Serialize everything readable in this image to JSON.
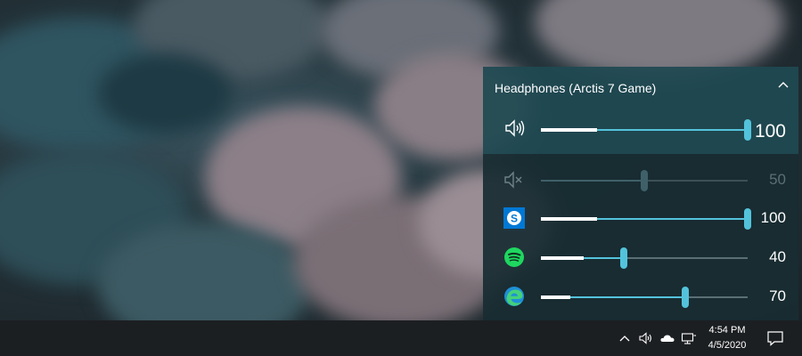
{
  "flyout": {
    "device_name": "Headphones (Arctis 7 Game)",
    "master": {
      "icon": "speaker-icon",
      "volume": 100,
      "label": "100"
    },
    "apps": [
      {
        "icon": "system-sounds-muted-icon",
        "volume": 50,
        "label": "50",
        "muted": true
      },
      {
        "icon": "skype-icon",
        "volume": 100,
        "label": "100",
        "muted": false
      },
      {
        "icon": "spotify-icon",
        "volume": 40,
        "label": "40",
        "muted": false
      },
      {
        "icon": "edge-icon",
        "volume": 70,
        "label": "70",
        "muted": false
      }
    ]
  },
  "taskbar": {
    "time": "4:54 PM",
    "date": "4/5/2020"
  },
  "colors": {
    "accent": "#53c3db",
    "panel_top": "#1f4952",
    "panel_bottom": "#182c32",
    "taskbar": "#1c1f22",
    "spotify": "#1ed760",
    "skype": "#0078d4"
  }
}
